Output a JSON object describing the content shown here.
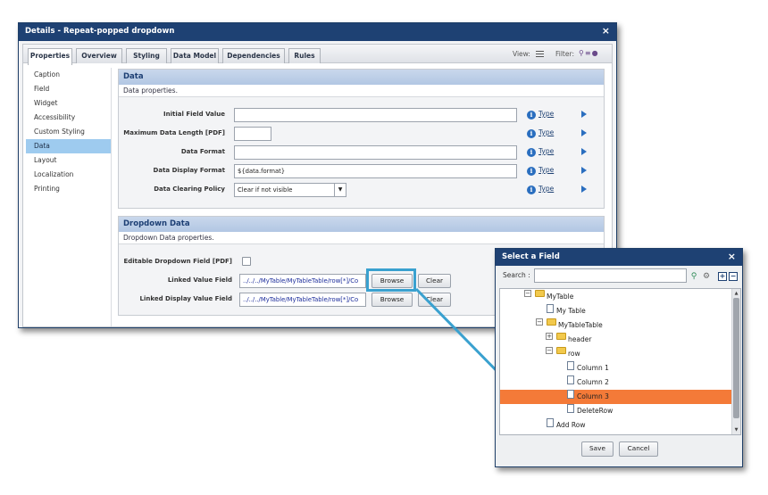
{
  "main_dialog": {
    "title": "Details - Repeat-popped dropdown",
    "close": "×",
    "tabs": [
      {
        "label": "Properties"
      },
      {
        "label": "Overview"
      },
      {
        "label": "Styling"
      },
      {
        "label": "Data Model"
      },
      {
        "label": "Dependencies"
      },
      {
        "label": "Rules"
      }
    ],
    "active_tab": "Properties",
    "view_label": "View:",
    "filter_label": "Filter:"
  },
  "sidebar": {
    "items": [
      {
        "label": "Caption"
      },
      {
        "label": "Field"
      },
      {
        "label": "Widget"
      },
      {
        "label": "Accessibility"
      },
      {
        "label": "Custom Styling"
      },
      {
        "label": "Data"
      },
      {
        "label": "Layout"
      },
      {
        "label": "Localization"
      },
      {
        "label": "Printing"
      }
    ],
    "active": "Data"
  },
  "data_panel": {
    "title": "Data",
    "subtitle": "Data properties.",
    "fields": [
      {
        "label": "Initial Field Value",
        "value": "",
        "type_link": "Type"
      },
      {
        "label": "Maximum Data Length [PDF]",
        "value": "",
        "type_link": "Type"
      },
      {
        "label": "Data Format",
        "value": "",
        "type_link": "Type"
      },
      {
        "label": "Data Display Format",
        "value": "${data.format}",
        "type_link": "Type"
      },
      {
        "label": "Data Clearing Policy",
        "value": "Clear if not visible",
        "type_link": "Type"
      }
    ]
  },
  "dropdown_panel": {
    "title": "Dropdown Data",
    "subtitle": "Dropdown Data properties.",
    "editable_label": "Editable Dropdown Field [PDF]",
    "linked_value_label": "Linked Value Field",
    "linked_value": "../../../MyTable/MyTableTable/row[*]/Co",
    "linked_display_label": "Linked Display Value Field",
    "linked_display_value": "../../../MyTable/MyTableTable/row[*]/Co",
    "browse_label": "Browse",
    "clear_label": "Clear"
  },
  "field_dialog": {
    "title": "Select a Field",
    "close": "×",
    "search_label": "Search :",
    "search_value": "",
    "tree": [
      {
        "label": "MyTable",
        "kind": "folder",
        "toggle": "−"
      },
      {
        "label": "My Table",
        "kind": "file"
      },
      {
        "label": "MyTableTable",
        "kind": "folder",
        "toggle": "−"
      },
      {
        "label": "header",
        "kind": "folder",
        "toggle": "+"
      },
      {
        "label": "row",
        "kind": "folder",
        "toggle": "−"
      },
      {
        "label": "Column 1",
        "kind": "file"
      },
      {
        "label": "Column 2",
        "kind": "file"
      },
      {
        "label": "Column 3",
        "kind": "file",
        "selected": true
      },
      {
        "label": "DeleteRow",
        "kind": "file"
      },
      {
        "label": "Add Row",
        "kind": "file"
      }
    ],
    "save_label": "Save",
    "cancel_label": "Cancel"
  },
  "colors": {
    "title_bar": "#1e4173",
    "panel_header": "#b2c7e3",
    "selected_sidebar": "#9ecbef",
    "selected_tree_row": "#f47a38",
    "callout": "#3aa1cf"
  }
}
